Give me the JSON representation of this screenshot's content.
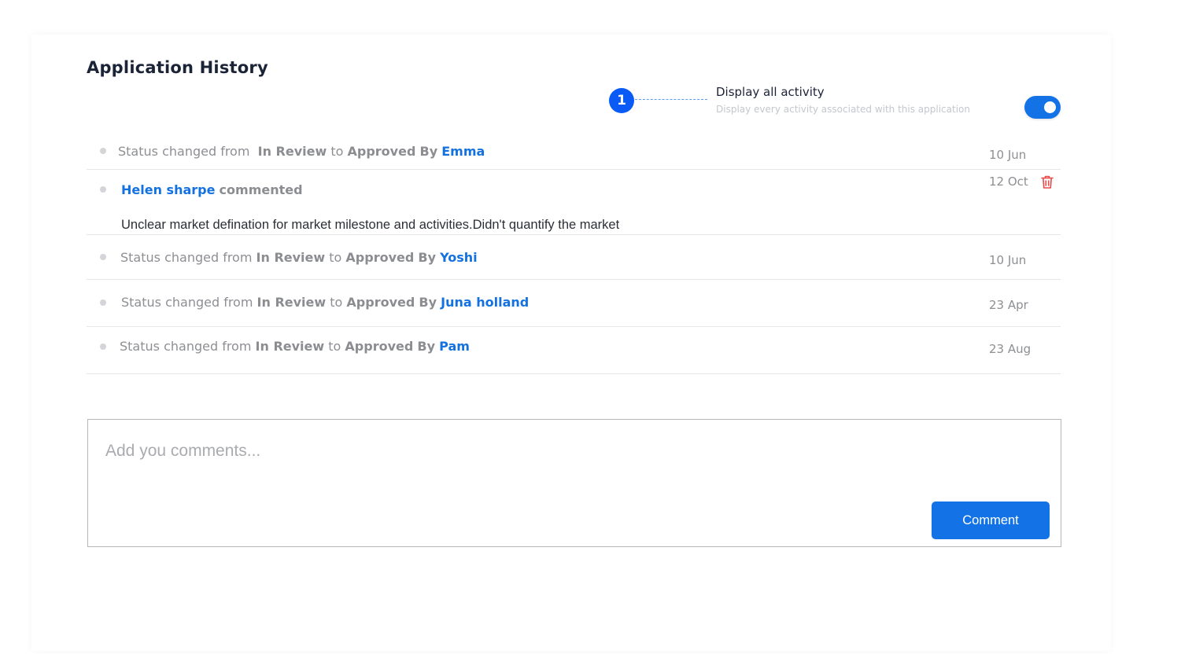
{
  "page": {
    "title": "Application History"
  },
  "toggle": {
    "step_number": "1",
    "title": "Display all activity",
    "subtitle": "Display every activity associated with this application",
    "enabled": true,
    "accent_color": "#1373e6"
  },
  "activities": [
    {
      "type": "status_change",
      "prefix": "Status changed from",
      "from_status": "In Review",
      "connector": "to",
      "to_status": "Approved",
      "by_label": "By",
      "user": "Emma",
      "date": "10 Jun"
    },
    {
      "type": "comment",
      "user": "Helen sharpe",
      "action": "commented",
      "body": "Unclear market defination for market milestone and activities.Didn't quantify the market",
      "date": "12 Oct",
      "icon": "trash-icon"
    },
    {
      "type": "status_change",
      "prefix": "Status changed from",
      "from_status": "In Review",
      "connector": "to",
      "to_status": "Approved",
      "by_label": "By",
      "user": "Yoshi",
      "date": "10 Jun"
    },
    {
      "type": "status_change",
      "prefix": "Status changed from",
      "from_status": "In Review",
      "connector": "to",
      "to_status": "Approved",
      "by_label": "By",
      "user": "Juna holland",
      "date": "23 Apr"
    },
    {
      "type": "status_change",
      "prefix": "Status changed from",
      "from_status": "In Review",
      "connector": "to",
      "to_status": "Approved",
      "by_label": "By",
      "user": "Pam",
      "date": "23 Aug"
    }
  ],
  "comment_form": {
    "placeholder": "Add you comments...",
    "value": "",
    "submit_label": "Comment"
  }
}
